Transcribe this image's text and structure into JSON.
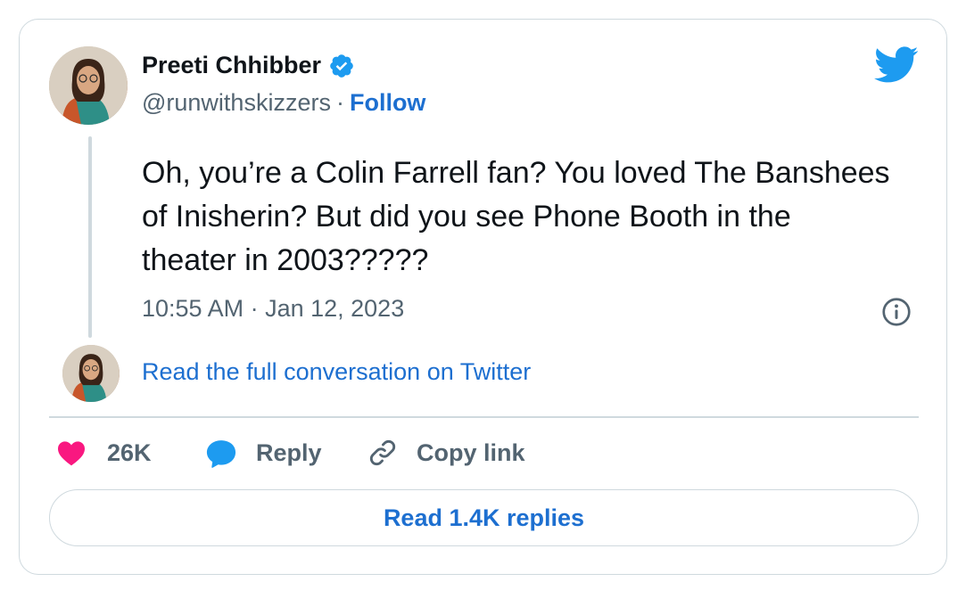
{
  "author": {
    "name": "Preeti Chhibber",
    "handle": "@runwithskizzers",
    "separator": "·",
    "follow_label": "Follow"
  },
  "tweet": {
    "text": "Oh, you’re a Colin Farrell fan? You loved The Banshees of Inisherin? But did you see Phone Booth in the theater in 2003?????",
    "timestamp": "10:55 AM · Jan 12, 2023"
  },
  "conversation_link": "Read the full conversation on Twitter",
  "actions": {
    "likes": "26K",
    "reply_label": "Reply",
    "copy_link_label": "Copy link"
  },
  "read_replies_label": "Read 1.4K replies",
  "icons": {
    "verified": "verified-badge-icon",
    "brand": "twitter-bird-icon",
    "info": "info-icon",
    "like": "heart-icon",
    "reply": "speech-bubble-icon",
    "copy": "link-icon"
  },
  "colors": {
    "link_blue": "#1d6fd0",
    "twitter_blue": "#1d9bf0",
    "like_pink": "#f91880",
    "muted_text": "#536471",
    "border": "#cfd9de"
  }
}
